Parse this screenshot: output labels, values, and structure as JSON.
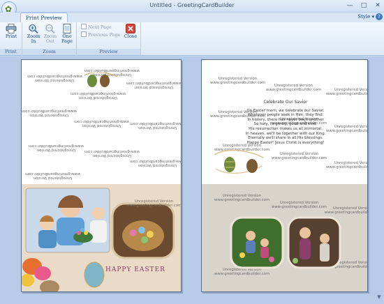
{
  "window": {
    "title": "Untitled - GreetingCardBuilder"
  },
  "ribbon": {
    "tab": "Print Preview",
    "style_menu": "Style",
    "groups": {
      "print": {
        "label": "Print",
        "print_button": "Print"
      },
      "zoom": {
        "label": "Zoom",
        "zoom_in": "Zoom\nIn",
        "zoom_in_l1": "Zoom",
        "zoom_in_l2": "In",
        "zoom_out_l1": "Zoom",
        "zoom_out_l2": "Out",
        "one_page_l1": "One",
        "one_page_l2": "Page"
      },
      "preview": {
        "label": "Preview",
        "next_page": "Next Page",
        "previous_page": "Previous Page",
        "close": "Close"
      }
    }
  },
  "card": {
    "watermark_line1": "Unregistered Version",
    "watermark_line2": "www.greetingcardbuilder.com",
    "poem_title": "Celebrate Our Savior",
    "poem_lines": [
      "On Easter morn, we celebrate our Savior.",
      "Whatever people seek in Him, they find.",
      "In history, there has never been another",
      "So holy, forgiving, good and kind.",
      "His resurrection makes us all immortal.",
      "In heaven, we'll be together with our King.",
      "Eternally we'll share in all His blessings.",
      "Happy Easter! Jesus Christ is everything!"
    ],
    "happy_easter": "HAPPY EASTER"
  }
}
